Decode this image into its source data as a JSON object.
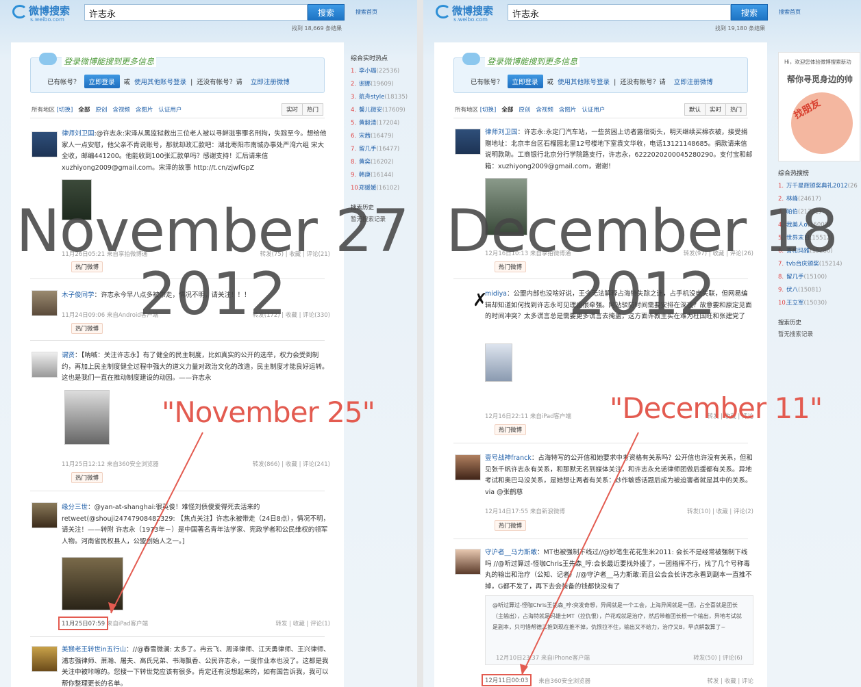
{
  "overlays": {
    "left_date": "November 27\n2012",
    "right_date": "December 18\n2012",
    "left_callout": "\"November 25\"",
    "right_callout": "\"December 11\""
  },
  "left": {
    "logo": "微博搜索",
    "logo_sub": "s.weibo.com",
    "search_value": "许志永",
    "search_button": "搜索",
    "home": "搜索首页",
    "count": "找到 18,669 条结果",
    "login": {
      "title": "登录微博能搜到更多信息",
      "have": "已有帐号？",
      "login_btn": "立即登录",
      "or": "或",
      "other": "使用其他账号登录",
      "noacc": "还没有帐号？请",
      "register": "立即注册微博"
    },
    "filters": {
      "region": "所有地区",
      "switch": "[切换]",
      "all": "全部",
      "orig": "原创",
      "video": "含视频",
      "pic": "含图片",
      "verified": "认证用户"
    },
    "sorts": [
      "实时",
      "热门"
    ],
    "posts": [
      {
        "user": "律师刘卫国",
        "text": ":@许志永:宋泽从黑监狱救出三位老人被以寻衅滋事罪名刑拘，失踪至今。想给他家人一点安慰，他父亲不肯说账号，那就却政汇款吧：湖北枣阳市南城办事处严湾六组 宋大全收，邮编441200。他能收到100张汇款单吗？感谢支持！汇后请来信xuzhiyong2009@gmail.com。宋泽的故事 http://t.cn/zjwfGpZ",
        "time": "11月26日05:21",
        "src": "来自享拍微博通",
        "stats": "转发(75) | 收藏 | 评论(21)",
        "hot": "热门微博"
      },
      {
        "user": "木子俊同学",
        "text": "：许志永今早八点多被带走，情况不明，请关注！！！",
        "time": "11月24日09:06",
        "src": "来自Android客户端",
        "stats": "转发(172) | 收藏 | 评论(330)",
        "hot": "热门微博"
      },
      {
        "user": "谓贤",
        "text": "：【呐喊：关注许志永】有了健全的民主制度，比如真实的公开的选举，权力会受到制约，再加上民主制度健全过程中强大的道义力量对政治文化的改造，民主制度才能良好运转。这也是我们一直在推动制度建设的动因。——许志永",
        "time": "11月25日12:12",
        "src": "来自360安全浏览器",
        "stats": "转发(866) | 收藏 | 评论(241)",
        "hot": "热门微博"
      },
      {
        "user": "缘分三世",
        "text": "：@yan-at-shanghai:很英俊！难怪刘债傻爱得死去活来的 retweet(@shouji24747908482329: 【焦点关注】许志永被带走（24日8点），情况不明，请关注！——转附 许志永（1973年－）是中国著名青年法学家、宪政学者和公民维权的领军人物。河南省民权县人，公盟创始人之一。]",
        "time": "11月25日07:59",
        "src": "来自iPad客户端",
        "stats": "转发 | 收藏 | 评论(1)"
      },
      {
        "user": "美猴老王转世in五行山",
        "text": "：//@春雪微澜: 太多了。冉云飞、周泽律师、江天勇律师、王兴律师、浦志强律师、萧瀚、屠夫、高氏兄弟、书海飘香、公民许志永，一度作业本也没了。这都是我关注中被咔嚓的。您搜一下转世党应该有很多。肯定还有没想起来的，如有国告诉我，我可以帮你整理更长的名单。",
        "time": "",
        "src": "",
        "stats": ""
      }
    ],
    "sidebar": {
      "title": "综合实时热点",
      "items": [
        {
          "n": "1.",
          "t": "李小璐",
          "c": "(22536)"
        },
        {
          "n": "2.",
          "t": "谢娜",
          "c": "(19609)"
        },
        {
          "n": "3.",
          "t": "航舟style",
          "c": "(18135)"
        },
        {
          "n": "4.",
          "t": "馨儿微安",
          "c": "(17609)"
        },
        {
          "n": "5.",
          "t": "黄毅清",
          "c": "(17204)"
        },
        {
          "n": "6.",
          "t": "宋茜",
          "c": "(16479)"
        },
        {
          "n": "7.",
          "t": "留几手",
          "c": "(16477)"
        },
        {
          "n": "8.",
          "t": "黄奕",
          "c": "(16202)"
        },
        {
          "n": "9.",
          "t": "韩庚",
          "c": "(16144)"
        },
        {
          "n": "10.",
          "t": "郑媛媛",
          "c": "(16102)"
        }
      ],
      "history": "搜索历史",
      "history_empty": "暂无搜索记录"
    }
  },
  "right": {
    "logo": "微博搜索",
    "logo_sub": "s.weibo.com",
    "search_value": "许志永",
    "search_button": "搜索",
    "home": "搜索首页",
    "count": "找到 19,180 条结果",
    "login": {
      "title": "登录微博能搜到更多信息",
      "have": "已有帐号？",
      "login_btn": "立即登录",
      "or": "或",
      "other": "使用其他账号登录",
      "noacc": "还没有帐号？请",
      "register": "立即注册微博"
    },
    "filters": {
      "region": "所有地区",
      "switch": "[切换]",
      "all": "全部",
      "orig": "原创",
      "video": "含视频",
      "pic": "含图片",
      "verified": "认证用户"
    },
    "sorts": [
      "默认",
      "实时",
      "热门"
    ],
    "ad": {
      "hint": "Hi，欢迎您体验微博搜索新功",
      "title": "帮你寻觅身边的帅",
      "badge": "找朋友"
    },
    "posts": [
      {
        "user": "律师刘卫国",
        "text": "：许志永:永定门汽车站，一些贫困上访者露宿街头，明天继续买棉衣被，接受捐赠地址：北京丰台区石榴园北里12号楼地下室袁文华收，电话13121148685。捐款请来信说明款助。工商银行北京分行学院路支行，许志永，6222020200045280290。支付宝和邮箱：xuzhiyong2009@gmail.com，谢谢！",
        "time": "12月16日10:13",
        "src": "来自享拍微博通",
        "stats": "转发(97) | 收藏 | 评论(26)",
        "hot": "热门微博"
      },
      {
        "user": "midiya",
        "text": "：公盟内部也没啥好说，王今无法解释占海特失踪之迷，占手机没电失联，但网易编辑却知道如何找到许志永可见理由很牵强。网站驳防时间需要安排在深夜？故意要和原定见面的时间冲突？太多谎言总是需要更多谎言去掩盖，这方面许教主实在难为杜国旺和张建党了",
        "time": "12月16日22:11",
        "src": "来自iPad客户端",
        "stats": "转发 | 收藏 | 评论",
        "hot": "热门微博"
      },
      {
        "user": "壹号战神franck",
        "text": "：占海特写的公开信和她要求中考资格有关系吗？公开信也许没有关系，但和见张千帆许志永有关系，和那默无名到媒体关注，和许志永允诺律师团做后援都有关系。异地考试和奥巴马没关系，是她想让两者有关系：炒作敏感话题后成为被迫害者就是其中的关系。via @张鹤慈",
        "time": "12月14日17:55",
        "src": "来自新浪微博",
        "stats": "转发(10) | 收藏 | 评论(2)",
        "hot": "热门微博"
      },
      {
        "user": "守沪者__马力斯敢",
        "text": "：MT也被强制下线过//@妙笔生花花生米2011: 会长不是经常被强制下线吗 //@听过算过-怪咖Chris王先森_哼:会长最近要找外援了，一团指挥不行，找了几个号称毒丸的输出和治疗（公知、记者）//@守沪者__马力斯敢:而且公会会长许志永看到副本一直推不掉，G都不发了，再下去会装备的钱都快没有了",
        "quote": "@听过算过-怪咖Chris王先森_哼:突发奇想，异闻就是一个工会，上海异闻就是一团，占全喜就是团长（主输出），占海特就是玛雄士MT（拉仇恨），芦花戏就是治疗，然后带着团长根一个输出，异地考试就是副本，只可惜帮德三推到现在推不掉，仇恨拉不住，输出又不给力，治疗又B，早点解散算了~",
        "quote_time": "12月10日23:37",
        "quote_src": "来自iPhone客户端",
        "quote_stats": "转发(50) | 评论(6)",
        "time": "12月11日00:03",
        "src": "来自360安全浏览器",
        "stats": "转发 | 收藏 | 评论"
      }
    ],
    "sidebar": {
      "title": "综合热搜榜",
      "items": [
        {
          "n": "1.",
          "t": "万千星辉颁奖典礼2012",
          "c": "(26"
        },
        {
          "n": "2.",
          "t": "林峰",
          "c": "(24617)"
        },
        {
          "n": "3.",
          "t": "帕伯",
          "c": "(21731)"
        },
        {
          "n": "4.",
          "t": "我美人o",
          "c": "(16000)"
        },
        {
          "n": "5.",
          "t": "世界末日",
          "c": "(15512)"
        },
        {
          "n": "6.",
          "t": "喜和玛雅",
          "c": "(15280)"
        },
        {
          "n": "7.",
          "t": "tvb台庆颁奖",
          "c": "(15214)"
        },
        {
          "n": "8.",
          "t": "留几手",
          "c": "(15100)"
        },
        {
          "n": "9.",
          "t": "伏八",
          "c": "(15081)"
        },
        {
          "n": "10.",
          "t": "王立军",
          "c": "(15030)"
        }
      ],
      "history": "搜索历史",
      "history_empty": "暂无搜索记录"
    }
  }
}
